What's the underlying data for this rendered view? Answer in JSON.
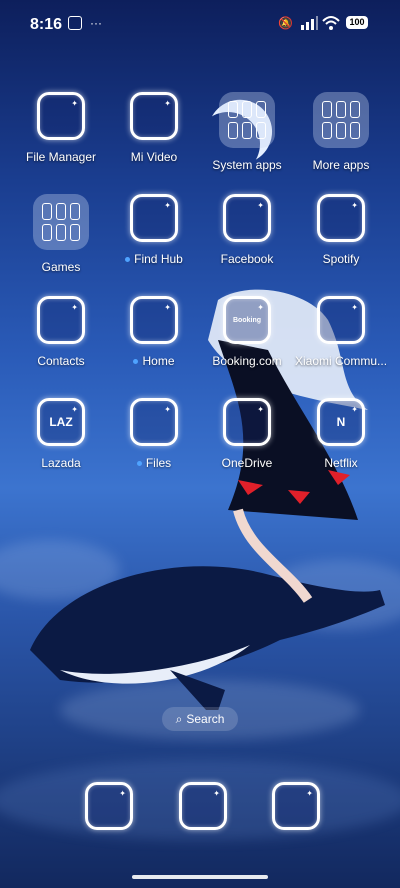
{
  "status_bar": {
    "time": "8:16",
    "battery": "100"
  },
  "apps": [
    {
      "label": "File Manager",
      "icon": "folder-icon"
    },
    {
      "label": "Mi Video",
      "icon": "video-icon"
    },
    {
      "label": "System apps",
      "icon": "folder-grid-icon"
    },
    {
      "label": "More apps",
      "icon": "folder-grid-icon"
    },
    {
      "label": "Games",
      "icon": "folder-grid-icon"
    },
    {
      "label": "Find Hub",
      "icon": "find-hub-icon",
      "new_dot": true
    },
    {
      "label": "Facebook",
      "icon": "facebook-icon"
    },
    {
      "label": "Spotify",
      "icon": "spotify-icon"
    },
    {
      "label": "Contacts",
      "icon": "contacts-icon"
    },
    {
      "label": "Home",
      "icon": "home-icon",
      "new_dot": true
    },
    {
      "label": "Booking.com",
      "icon": "booking-icon",
      "icon_text": "Booking"
    },
    {
      "label": "Xiaomi Commu...",
      "icon": "xiaomi-community-icon"
    },
    {
      "label": "Lazada",
      "icon": "lazada-icon",
      "icon_text": "LAZ"
    },
    {
      "label": "Files",
      "icon": "files-icon",
      "new_dot": true
    },
    {
      "label": "OneDrive",
      "icon": "onedrive-icon"
    },
    {
      "label": "Netflix",
      "icon": "netflix-icon",
      "icon_text": "N"
    }
  ],
  "search": {
    "label": "Search"
  },
  "dock": [
    {
      "icon": "security-icon"
    },
    {
      "icon": "messages-icon"
    },
    {
      "icon": "browser-icon"
    }
  ]
}
